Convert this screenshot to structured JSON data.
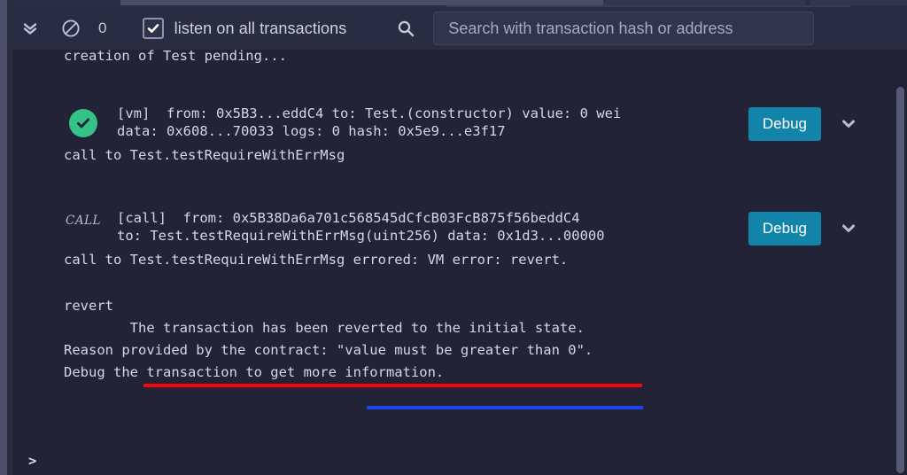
{
  "toolbar": {
    "collapse_all_icon": "double-chevron-down-icon",
    "clear_console_icon": "ban-icon",
    "pending_count": "0",
    "listen_checkbox_checked": true,
    "listen_label": "listen on all transactions",
    "search_icon": "search-icon",
    "search_value": "",
    "search_placeholder": "Search with transaction hash or address"
  },
  "terminal": {
    "pending_line": "creation of Test pending...",
    "prompt_symbol": ">",
    "transactions": [
      {
        "status_type": "success",
        "status_icon": "check-circle-icon",
        "detail_line_1": "[vm]  from: 0x5B3...eddC4 to: Test.(constructor) value: 0 wei",
        "detail_line_2": "data: 0x608...70033 logs: 0 hash: 0x5e9...e3f17",
        "summary": "call to Test.testRequireWithErrMsg",
        "debug_label": "Debug",
        "expand_icon": "chevron-down-icon"
      },
      {
        "status_type": "call",
        "status_badge": "CALL",
        "detail_line_1": "[call]  from: 0x5B38Da6a701c568545dCfcB03FcB875f56beddC4",
        "detail_line_2": "to: Test.testRequireWithErrMsg(uint256) data: 0x1d3...00000",
        "summary": "call to Test.testRequireWithErrMsg errored: VM error: revert.",
        "debug_label": "Debug",
        "expand_icon": "chevron-down-icon"
      }
    ],
    "revert": {
      "heading": "revert",
      "line_1": "\tThe transaction has been reverted to the initial state.",
      "line_2": "Reason provided by the contract: \"value must be greater than 0\".",
      "line_3": "Debug the transaction to get more information."
    }
  },
  "annotations": {
    "red_underline_color": "#fb0606",
    "blue_underline_color": "#1745f0"
  },
  "colors": {
    "background": "#222336",
    "toolbar_background": "#2a2c42",
    "debug_button": "#1283a9",
    "success_green": "#35c288",
    "text": "#d4d7e6",
    "placeholder": "#a7abc2"
  },
  "scrollbar": {
    "vertical_thumb": "vertical-scrollbar-thumb"
  }
}
